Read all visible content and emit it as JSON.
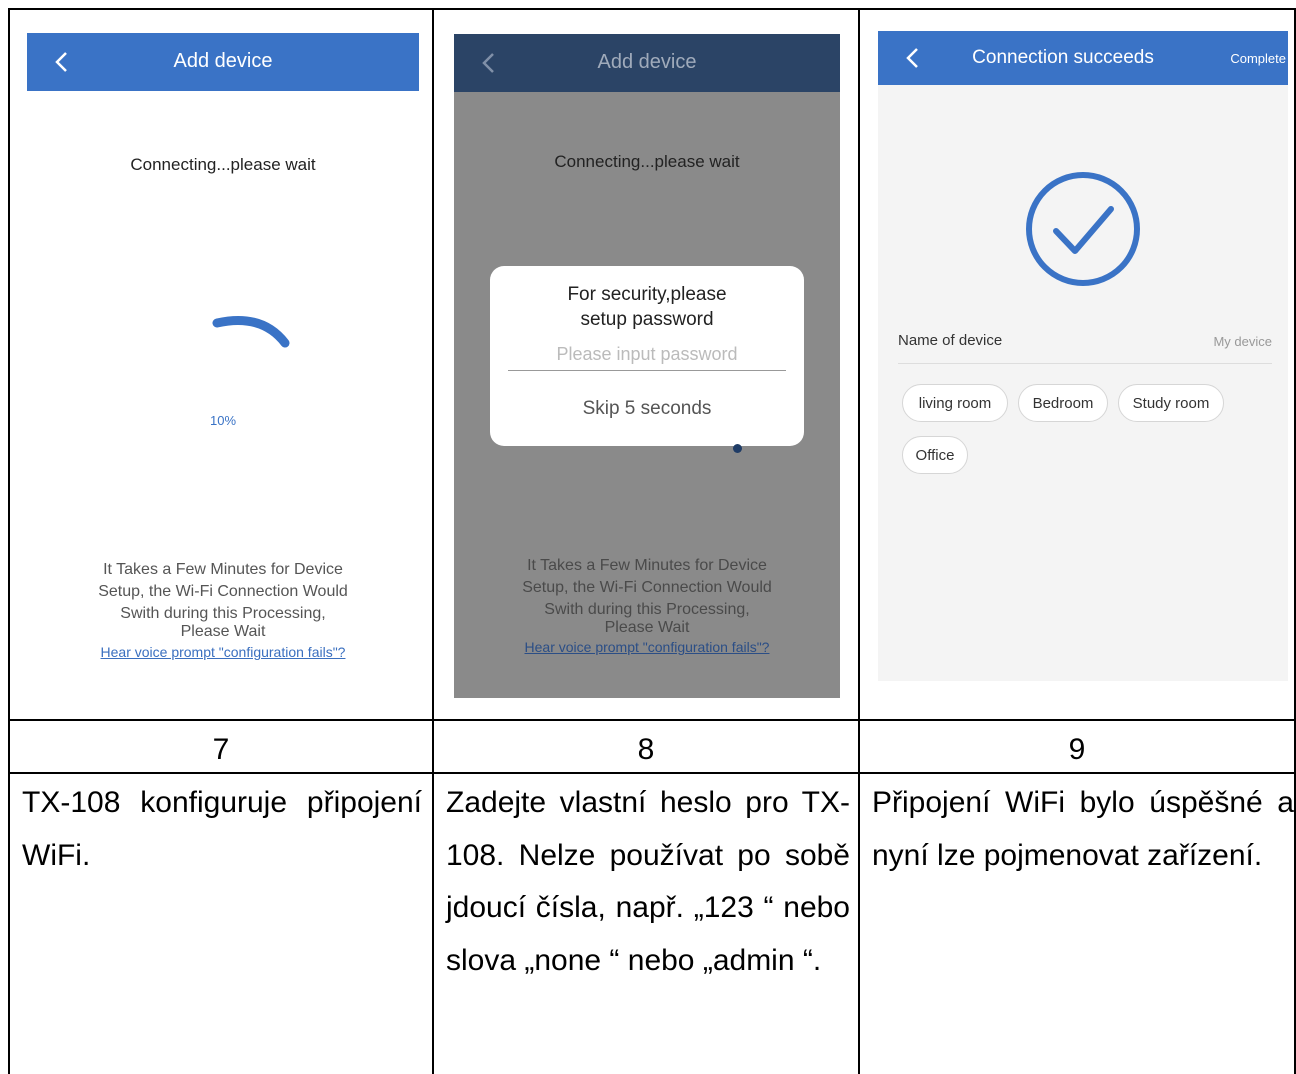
{
  "step7": {
    "screen": {
      "title": "Add device",
      "status": "Connecting...please wait",
      "progress_percent": 10,
      "progress_label": "10%",
      "message_lines": [
        "It Takes a Few Minutes for Device",
        "Setup, the Wi-Fi Connection Would",
        "Swith during this Processing,",
        "Please Wait"
      ],
      "help_link": "Hear voice prompt \"configuration fails\"?"
    },
    "number": "7",
    "description": "TX-108 konfiguruje připojení WiFi."
  },
  "step8": {
    "screen": {
      "title": "Add device",
      "status": "Connecting...please wait",
      "dialog_title_lines": [
        "For security,please",
        "setup password"
      ],
      "password_placeholder": "Please input password",
      "skip_label": "Skip 5 seconds",
      "message_lines": [
        "It Takes a Few Minutes for Device",
        "Setup, the Wi-Fi Connection Would",
        "Swith during this Processing,",
        "Please Wait"
      ],
      "help_link": "Hear voice prompt \"configuration fails\"?"
    },
    "number": "8",
    "description": "Zadejte vlastní heslo pro TX-108. Nelze používat po sobě jdoucí čísla, např. „123 “ nebo slova „none “ nebo „admin “."
  },
  "step9": {
    "screen": {
      "title": "Connection succeeds",
      "complete_label": "Complete",
      "name_label": "Name of device",
      "name_value": "My device",
      "room_chips": [
        "living room",
        "Bedroom",
        "Study room",
        "Office"
      ]
    },
    "number": "9",
    "description": "Připojení WiFi bylo úspěšné a nyní lze pojmenovat zařízení."
  },
  "colors": {
    "accent": "#3a73c6",
    "overlay": "#8a8a8a",
    "overlay_bar": "#2b4466"
  }
}
